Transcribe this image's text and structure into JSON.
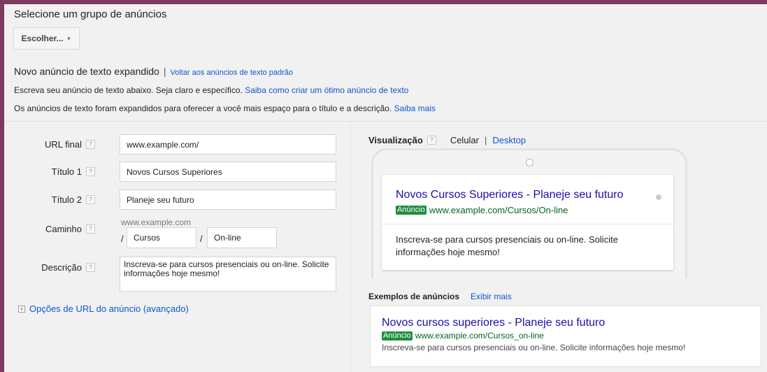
{
  "ad_group": {
    "heading": "Selecione um grupo de anúncios",
    "choose_button": "Escolher..."
  },
  "new_ad": {
    "heading": "Novo anúncio de texto expandido",
    "separator": "|",
    "back_link": "Voltar aos anúncios de texto padrão",
    "info_1_text": "Escreva seu anúncio de texto abaixo. Seja claro e específico.",
    "info_1_link": "Saiba como criar um ótimo anúncio de texto",
    "info_2_text": "Os anúncios de texto foram expandidos para oferecer a você mais espaço para o título e a descrição.",
    "info_2_link": "Saiba mais"
  },
  "form": {
    "help_glyph": "?",
    "final_url": {
      "label": "URL final",
      "value": "www.example.com/"
    },
    "title_1": {
      "label": "Título 1",
      "value": "Novos Cursos Superiores"
    },
    "title_2": {
      "label": "Título 2",
      "value": "Planeje seu futuro"
    },
    "path": {
      "label": "Caminho",
      "base": "www.example.com",
      "slash": "/",
      "part_1": "Cursos",
      "part_2": "On-line"
    },
    "description": {
      "label": "Descrição",
      "value": "Inscreva-se para cursos presenciais ou on-line. Solicite informações hoje mesmo!"
    },
    "url_options": {
      "plus": "+",
      "label": "Opções de URL do anúncio (avançado)"
    }
  },
  "preview": {
    "title": "Visualização",
    "mobile": "Celular",
    "separator": "|",
    "desktop": "Desktop",
    "ad": {
      "headline": "Novos Cursos Superiores - Planeje seu futuro",
      "badge": "Anúncio",
      "display_url": "www.example.com/Cursos/On-line",
      "description": "Inscreva-se para cursos presenciais ou on-line. Solicite informações hoje mesmo!"
    }
  },
  "examples": {
    "title": "Exemplos de anúncios",
    "show_more": "Exibir mais",
    "ad": {
      "headline": "Novos cursos superiores - Planeje seu futuro",
      "badge": "Anúncio",
      "display_url": "www.example.com/Cursos_on-line",
      "description": "Inscreva-se para cursos presenciais ou on-line. Solicite informações hoje mesmo!"
    }
  },
  "colors": {
    "link": "#1155cc",
    "ad_headline": "#1a0dab",
    "ad_url": "#006621",
    "ad_badge": "#1e8e3e",
    "frame_border": "#7b3a5f"
  }
}
